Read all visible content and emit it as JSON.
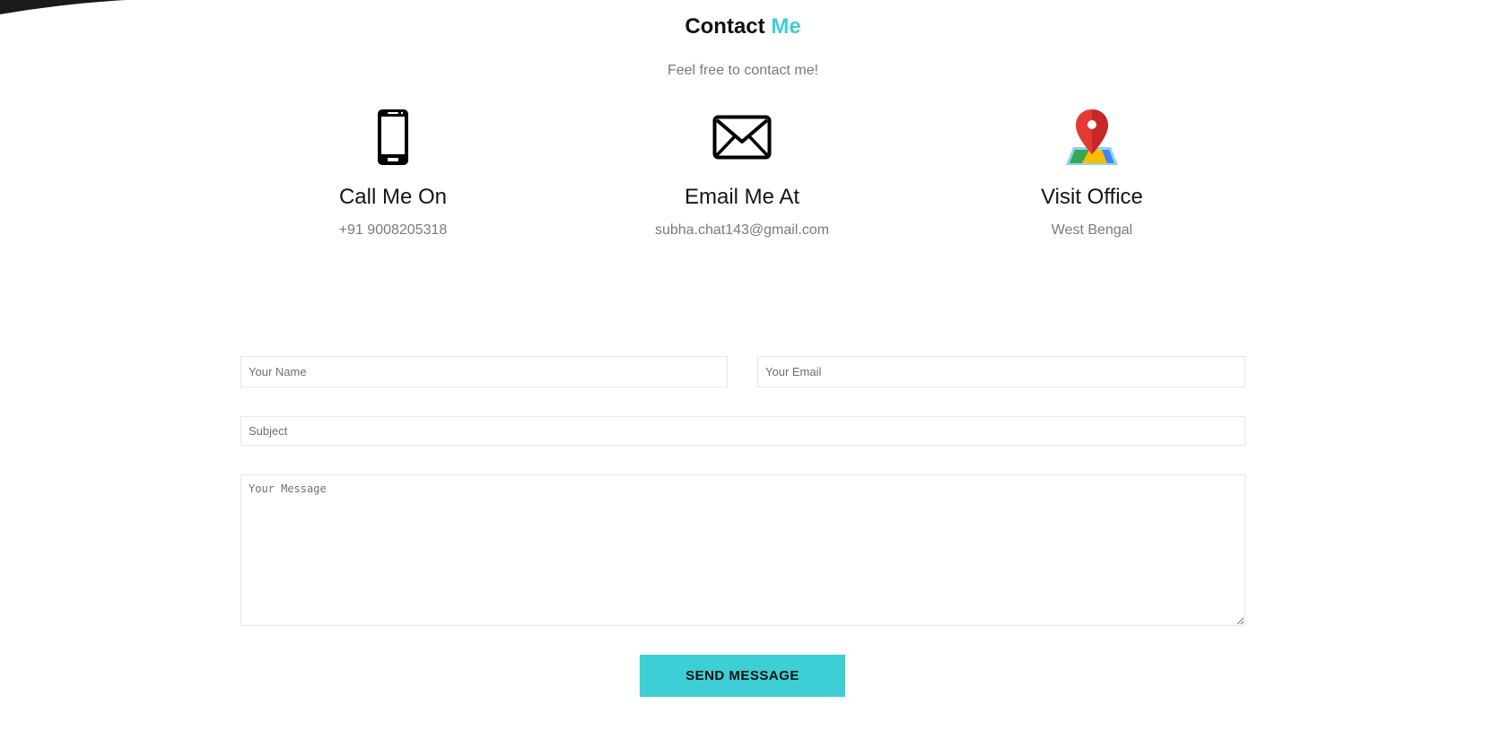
{
  "header": {
    "title_main": "Contact",
    "title_accent": "Me",
    "subtitle": "Feel free to contact me!"
  },
  "contact_info": [
    {
      "icon": "smartphone-icon",
      "title": "Call Me On",
      "value": "+91 9008205318"
    },
    {
      "icon": "envelope-icon",
      "title": "Email Me At",
      "value": "subha.chat143@gmail.com"
    },
    {
      "icon": "map-pin-icon",
      "title": "Visit Office",
      "value": "West Bengal"
    }
  ],
  "form": {
    "name_placeholder": "Your Name",
    "email_placeholder": "Your Email",
    "subject_placeholder": "Subject",
    "message_placeholder": "Your Message",
    "submit_label": "SEND MESSAGE"
  },
  "colors": {
    "accent": "#3ecfd6",
    "text_dark": "#111111",
    "text_muted": "#7a7a7a",
    "field_border": "#e6e6e6"
  }
}
